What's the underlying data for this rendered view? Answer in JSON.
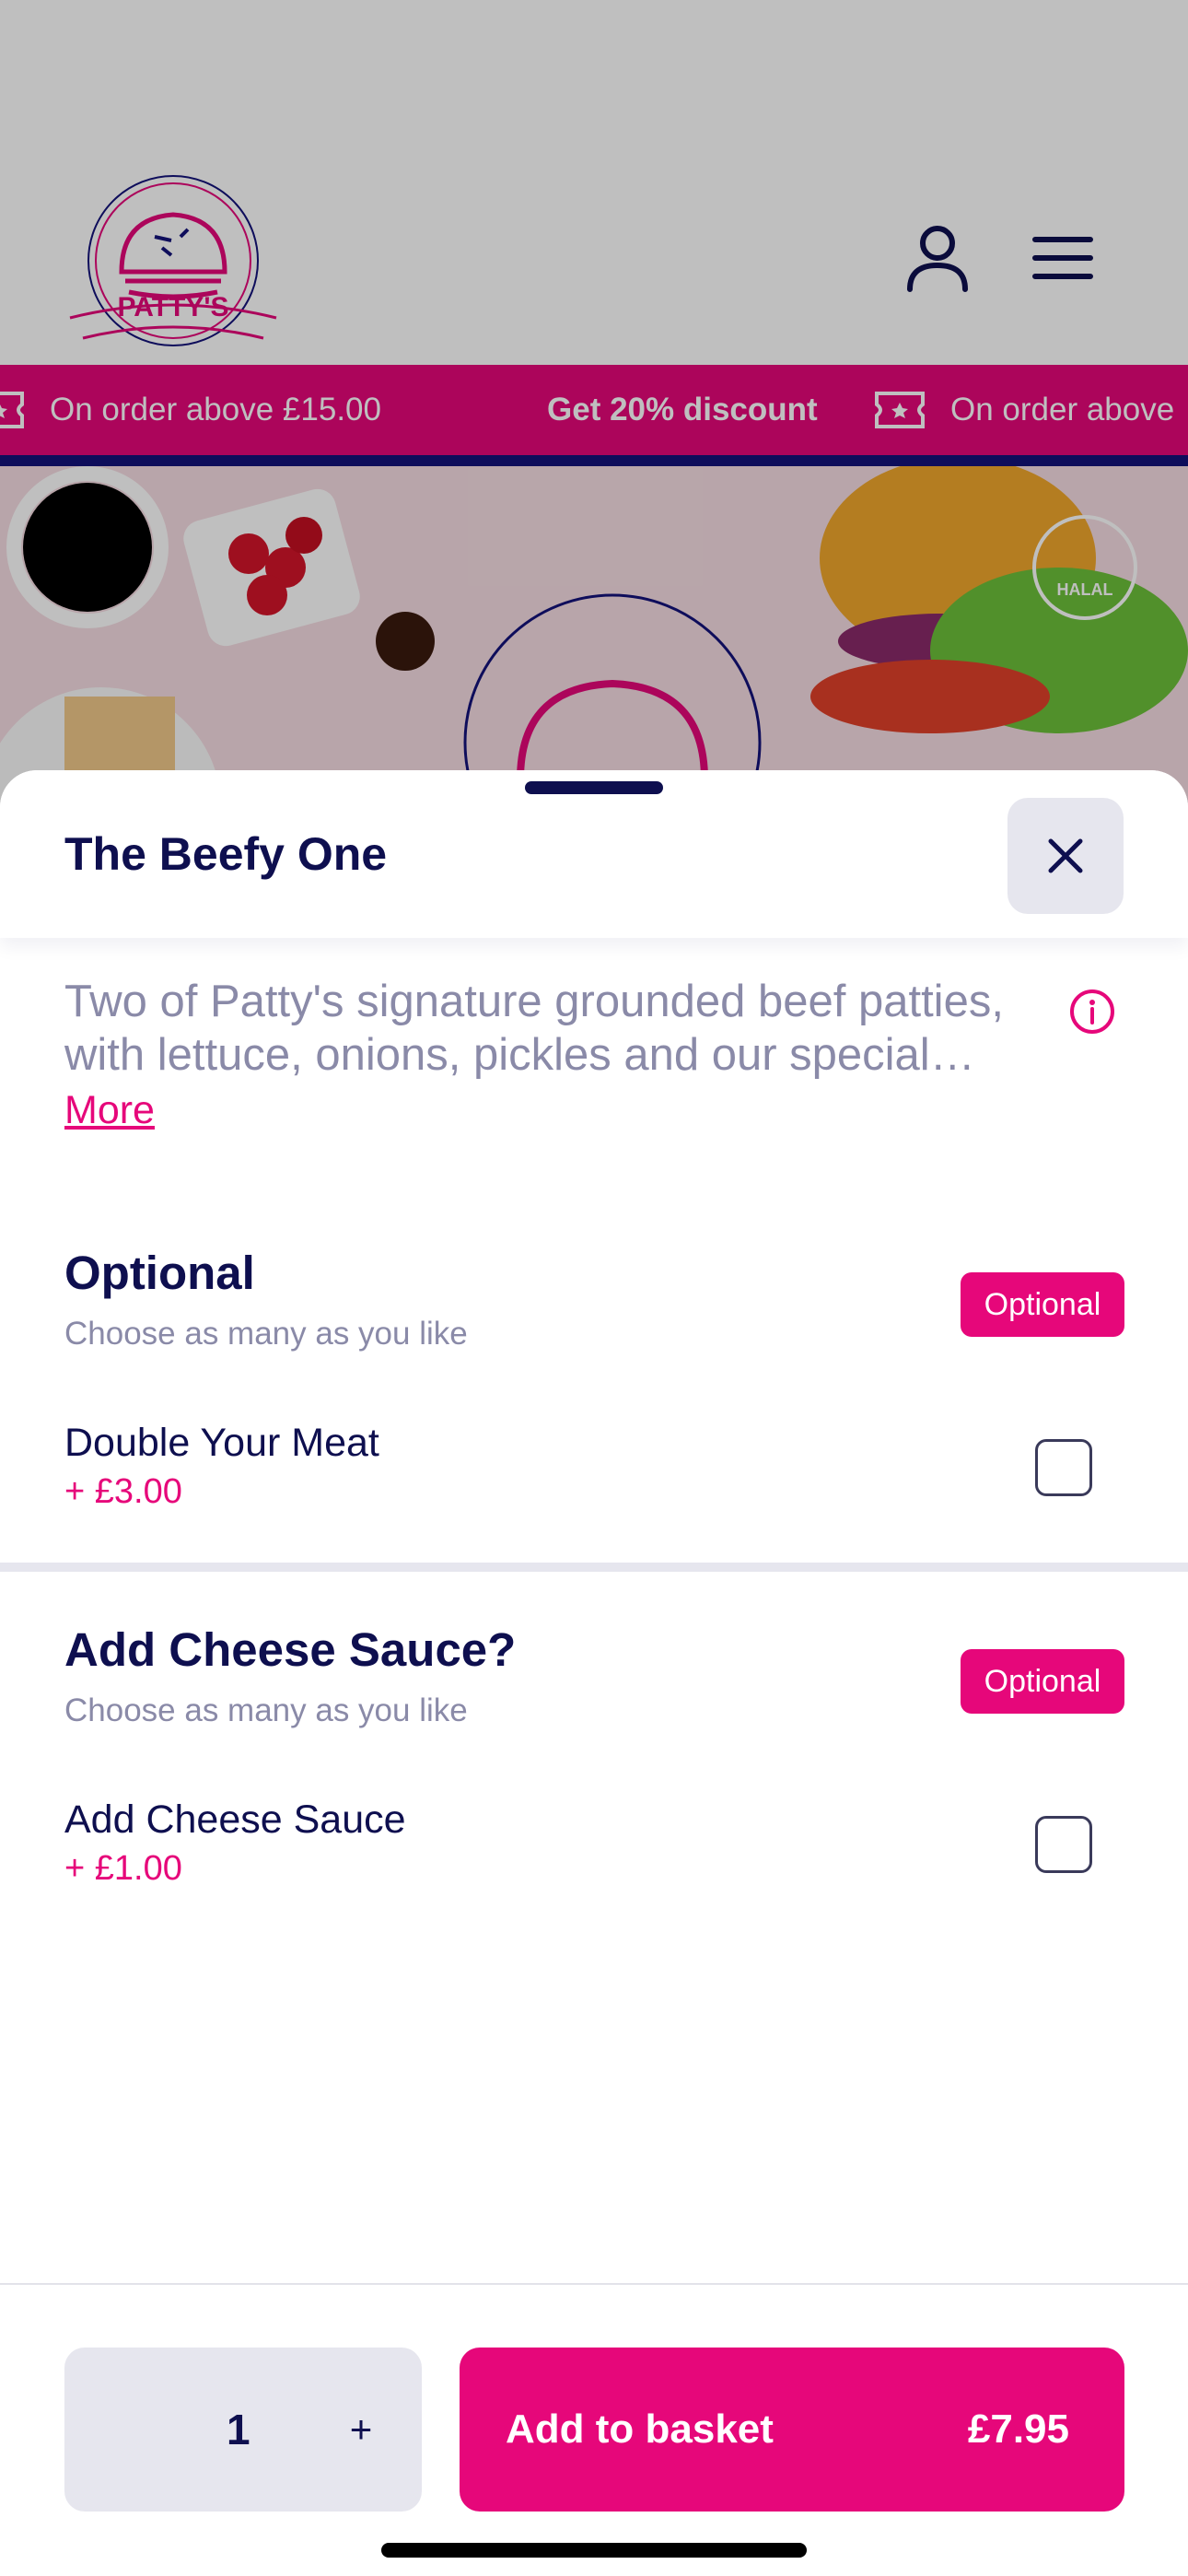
{
  "header": {
    "logo_text": "PATTY'S",
    "icons": [
      "account-icon",
      "hamburger-menu-icon"
    ]
  },
  "promo": {
    "items": [
      {
        "text": "On order above £15.00",
        "bold": false
      },
      {
        "text": "Get 20% discount",
        "bold": true
      },
      {
        "text": "On order above",
        "bold": false
      }
    ]
  },
  "hero": {
    "badge_text": "HALAL"
  },
  "sheet": {
    "title": "The Beefy One",
    "description": "Two of Patty's signature grounded beef patties, with lettuce, onions, pickles and our special sauce",
    "more_label": "More",
    "groups": [
      {
        "title": "Optional",
        "subtitle": "Choose as many as you like",
        "badge": "Optional",
        "options": [
          {
            "name": "Double  Your Meat",
            "price": "+ £3.00",
            "checked": false
          }
        ]
      },
      {
        "title": "Add Cheese Sauce?",
        "subtitle": "Choose as many as you like",
        "badge": "Optional",
        "options": [
          {
            "name": "Add Cheese Sauce",
            "price": "+ £1.00",
            "checked": false
          }
        ]
      }
    ]
  },
  "footer": {
    "quantity": "1",
    "plus_label": "+",
    "add_label": "Add to basket",
    "total": "£7.95"
  },
  "colors": {
    "brand_pink": "#e6077a",
    "brand_navy": "#0e0f4f",
    "muted_text": "#8a8aa8"
  }
}
